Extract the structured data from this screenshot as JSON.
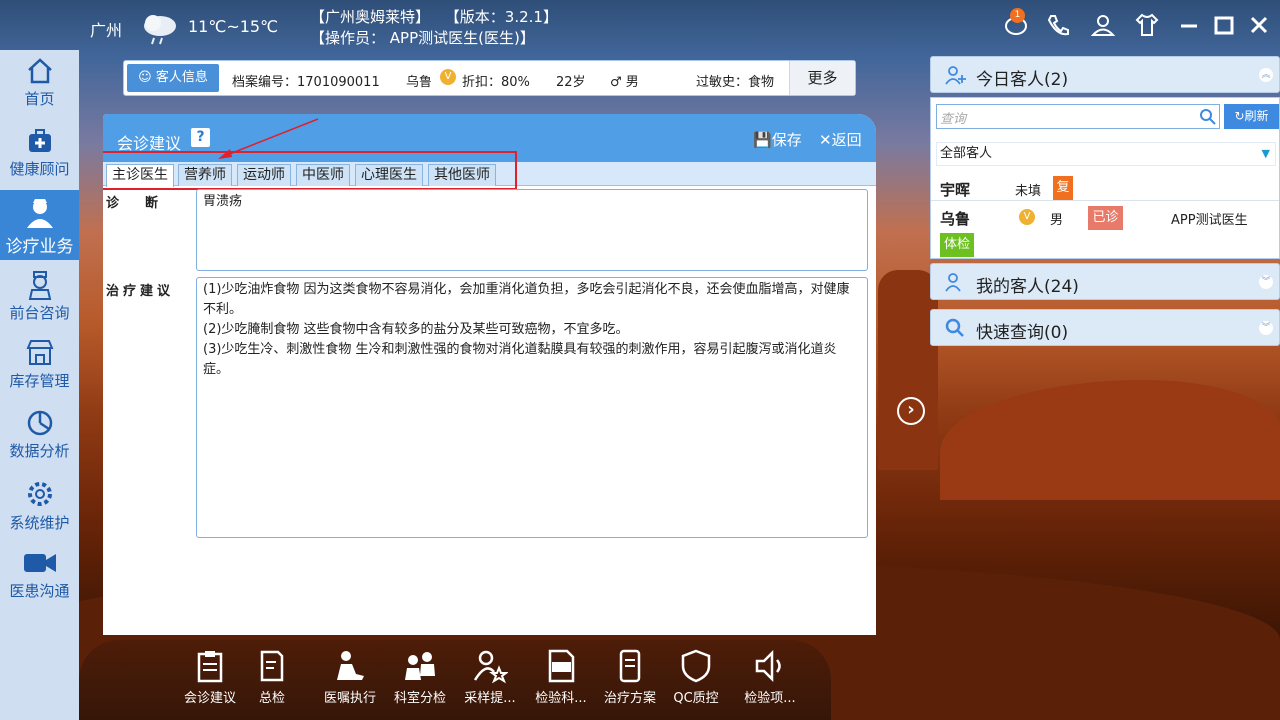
{
  "header": {
    "city": "广州",
    "temperature": "11℃~15℃",
    "company": "【广州奥姆莱特】",
    "version": "【版本：3.2.1】",
    "operator": "【操作员： APP测试医生(医生)】",
    "notification_count": "1"
  },
  "sidebar": {
    "items": [
      {
        "label": "首页",
        "icon": "home-icon"
      },
      {
        "label": "健康顾问",
        "icon": "medkit-icon"
      },
      {
        "label": "诊疗业务",
        "icon": "doctor-icon",
        "active": true
      },
      {
        "label": "前台咨询",
        "icon": "nurse-icon"
      },
      {
        "label": "库存管理",
        "icon": "store-icon"
      },
      {
        "label": "数据分析",
        "icon": "pie-chart-icon"
      },
      {
        "label": "系统维护",
        "icon": "gear-icon"
      },
      {
        "label": "医患沟通",
        "icon": "video-icon"
      }
    ]
  },
  "customer_info": {
    "tab_label": "客人信息",
    "record_no": "档案编号：1701090011",
    "name": "乌鲁",
    "vip": "V",
    "discount": "折扣：80%",
    "age": "22岁",
    "gender": "♂ 男",
    "allergy": "过敏史：食物",
    "more_label": "更多"
  },
  "consult": {
    "title": "会诊建议",
    "help": "?",
    "save_label": "保存",
    "back_label": "返回",
    "tabs": [
      "主诊医生",
      "营养师",
      "运动师",
      "中医师",
      "心理医生",
      "其他医师"
    ],
    "diagnosis_label": "诊　　断",
    "diagnosis_value": "胃溃疡",
    "treatment_label": "治疗建议",
    "treatment_lines": [
      "(1)少吃油炸食物 因为这类食物不容易消化，会加重消化道负担，多吃会引起消化不良，还会使血脂增高，对健康不利。",
      "(2)少吃腌制食物 这些食物中含有较多的盐分及某些可致癌物，不宜多吃。",
      "(3)少吃生冷、刺激性食物 生冷和刺激性强的食物对消化道黏膜具有较强的刺激作用，容易引起腹泻或消化道炎症。"
    ]
  },
  "right_panel": {
    "today_title": "今日客人(2)",
    "search_placeholder": "查询",
    "refresh_label": "刷新",
    "filter_value": "全部客人",
    "customers": [
      {
        "name": "宇晖",
        "status": "未填",
        "tag": "复"
      },
      {
        "name": "乌鲁",
        "vip": "V",
        "gender": "男",
        "tag": "已诊",
        "doctor": "APP测试医生",
        "extra_tag": "体检"
      }
    ],
    "my_customers_title": "我的客人(24)",
    "quick_search_title": "快速查询(0)"
  },
  "bottom_bar": {
    "items": [
      "会诊建议",
      "总检",
      "医嘱执行",
      "科室分检",
      "采样提...",
      "检验科...",
      "治疗方案",
      "QC质控",
      "检验项..."
    ]
  },
  "colors": {
    "accent": "#4f9ee6",
    "sidebar_active": "#3a86d6",
    "tag_orange": "#f07020",
    "tag_red": "#e87a6a",
    "tag_green": "#6cc020"
  }
}
